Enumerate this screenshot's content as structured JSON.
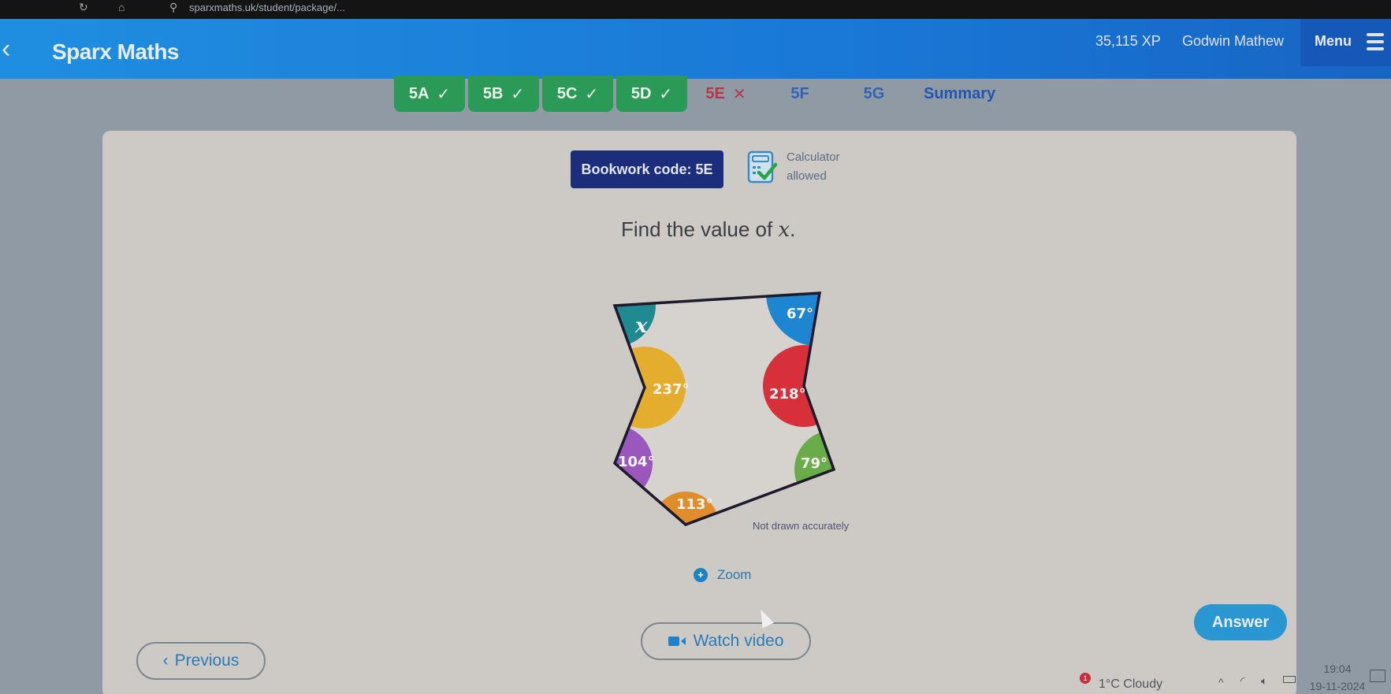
{
  "browser": {
    "url": "sparxmaths.uk/student/package/..."
  },
  "header": {
    "app_title": "Sparx Maths",
    "xp": "35,115 XP",
    "user_name": "Godwin Mathew",
    "menu_label": "Menu",
    "colors": {
      "bar": "#1a78d6",
      "menu_bg": "#1558b8"
    }
  },
  "tabs": [
    {
      "label": "5A",
      "status": "correct",
      "mark": "✓"
    },
    {
      "label": "5B",
      "status": "correct",
      "mark": "✓"
    },
    {
      "label": "5C",
      "status": "correct",
      "mark": "✓"
    },
    {
      "label": "5D",
      "status": "correct",
      "mark": "✓"
    },
    {
      "label": "5E",
      "status": "incorrect",
      "mark": "✕"
    },
    {
      "label": "5F",
      "status": "todo",
      "mark": ""
    },
    {
      "label": "5G",
      "status": "todo",
      "mark": ""
    },
    {
      "label": "Summary",
      "status": "summary",
      "mark": ""
    }
  ],
  "question": {
    "bookwork_code": "Bookwork code: 5E",
    "calculator_line1": "Calculator",
    "calculator_line2": "allowed",
    "prompt_prefix": "Find the value of ",
    "prompt_var": "x",
    "prompt_suffix": "."
  },
  "diagram": {
    "shape": "heptagon",
    "angles": [
      {
        "label": "x",
        "color": "#1f8a8f"
      },
      {
        "label": "67°",
        "color": "#1e86d0"
      },
      {
        "label": "218°",
        "color": "#d8303a"
      },
      {
        "label": "79°",
        "color": "#6aab4a"
      },
      {
        "label": "113°",
        "color": "#e08e2c"
      },
      {
        "label": "104°",
        "color": "#9a58bc"
      },
      {
        "label": "237°",
        "color": "#e4ad2e"
      }
    ],
    "note": "Not drawn accurately"
  },
  "actions": {
    "zoom_label": "Zoom",
    "previous_label": "Previous",
    "watch_video_label": "Watch video",
    "answer_label": "Answer"
  },
  "taskbar": {
    "alert_count": "1",
    "weather": "1°C  Cloudy",
    "time": "19:04",
    "date": "19-11-2024"
  }
}
